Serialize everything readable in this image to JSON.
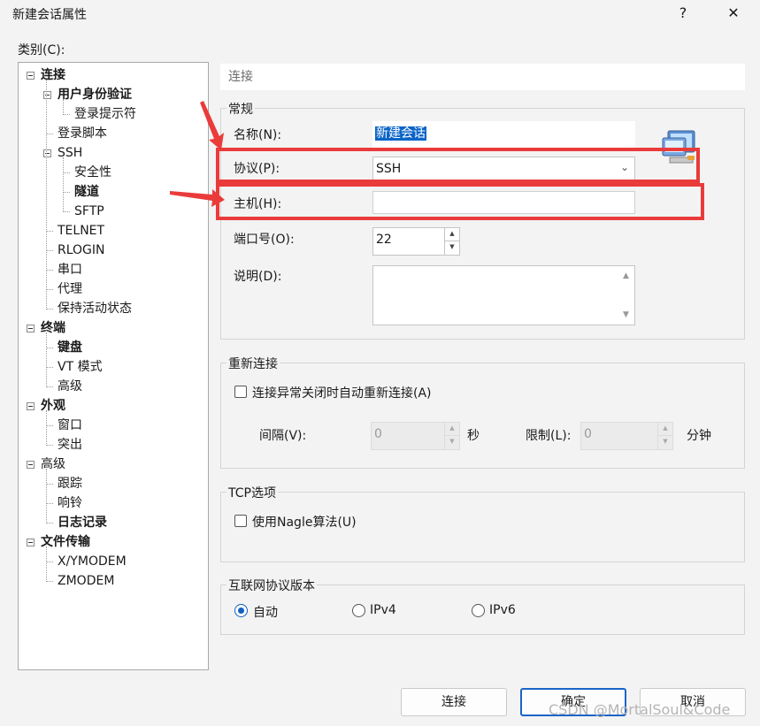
{
  "window": {
    "title": "新建会话属性",
    "help_glyph": "?",
    "close_glyph": "✕"
  },
  "category_label": "类别(C):",
  "tree": [
    {
      "label": "连接",
      "bold": true,
      "level": 0,
      "expander": true
    },
    {
      "label": "用户身份验证",
      "bold": true,
      "level": 1,
      "expander": true
    },
    {
      "label": "登录提示符",
      "bold": false,
      "level": 2
    },
    {
      "label": "登录脚本",
      "bold": false,
      "level": 1
    },
    {
      "label": "SSH",
      "bold": false,
      "level": 1,
      "expander": true
    },
    {
      "label": "安全性",
      "bold": false,
      "level": 2
    },
    {
      "label": "隧道",
      "bold": true,
      "level": 2
    },
    {
      "label": "SFTP",
      "bold": false,
      "level": 2
    },
    {
      "label": "TELNET",
      "bold": false,
      "level": 1
    },
    {
      "label": "RLOGIN",
      "bold": false,
      "level": 1
    },
    {
      "label": "串口",
      "bold": false,
      "level": 1
    },
    {
      "label": "代理",
      "bold": false,
      "level": 1
    },
    {
      "label": "保持活动状态",
      "bold": false,
      "level": 1
    },
    {
      "label": "终端",
      "bold": true,
      "level": 0,
      "expander": true
    },
    {
      "label": "键盘",
      "bold": true,
      "level": 1
    },
    {
      "label": "VT 模式",
      "bold": false,
      "level": 1
    },
    {
      "label": "高级",
      "bold": false,
      "level": 1
    },
    {
      "label": "外观",
      "bold": true,
      "level": 0,
      "expander": true
    },
    {
      "label": "窗口",
      "bold": false,
      "level": 1
    },
    {
      "label": "突出",
      "bold": false,
      "level": 1
    },
    {
      "label": "高级",
      "bold": false,
      "level": 0,
      "expander": true
    },
    {
      "label": "跟踪",
      "bold": false,
      "level": 1
    },
    {
      "label": "响铃",
      "bold": false,
      "level": 1
    },
    {
      "label": "日志记录",
      "bold": true,
      "level": 1
    },
    {
      "label": "文件传输",
      "bold": true,
      "level": 0,
      "expander": true
    },
    {
      "label": "X/YMODEM",
      "bold": false,
      "level": 1
    },
    {
      "label": "ZMODEM",
      "bold": false,
      "level": 1
    }
  ],
  "page_header": "连接",
  "general": {
    "title": "常规",
    "name_label": "名称(N):",
    "name_value": "新建会话",
    "protocol_label": "协议(P):",
    "protocol_value": "SSH",
    "host_label": "主机(H):",
    "host_value": "",
    "port_label": "端口号(O):",
    "port_value": "22",
    "desc_label": "说明(D):",
    "desc_value": "",
    "icon": "computer-network-icon"
  },
  "reconnect": {
    "title": "重新连接",
    "checkbox_label": "连接异常关闭时自动重新连接(A)",
    "checked": false,
    "interval_label": "间隔(V):",
    "interval_value": "0",
    "interval_unit": "秒",
    "limit_label": "限制(L):",
    "limit_value": "0",
    "limit_unit": "分钟"
  },
  "tcp": {
    "title": "TCP选项",
    "nagle_label": "使用Nagle算法(U)",
    "checked": false
  },
  "ip": {
    "title": "互联网协议版本",
    "options": [
      "自动",
      "IPv4",
      "IPv6"
    ],
    "selected": "自动"
  },
  "buttons": {
    "connect": "连接",
    "ok": "确定",
    "cancel": "取消"
  },
  "watermark": "CSDN @MortalSoul&Code",
  "colors": {
    "annotation_red": "#ea3b3b",
    "selection_blue": "#0a64c8",
    "accent": "#1a64c8"
  }
}
